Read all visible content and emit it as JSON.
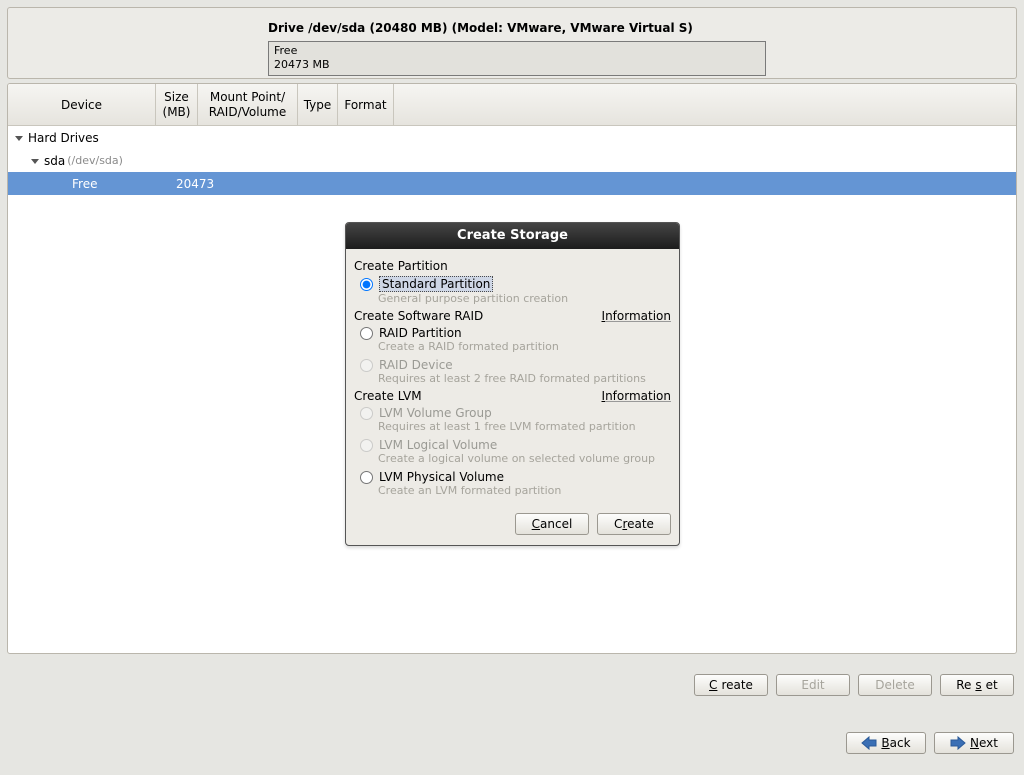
{
  "drive": {
    "title": "Drive /dev/sda (20480 MB) (Model: VMware, VMware Virtual S)",
    "free_label": "Free",
    "free_size": "20473 MB"
  },
  "columns": {
    "device": "Device",
    "size_l1": "Size",
    "size_l2": "(MB)",
    "mount_l1": "Mount Point/",
    "mount_l2": "RAID/Volume",
    "type": "Type",
    "format": "Format"
  },
  "tree": {
    "root_label": "Hard Drives",
    "sda_label": "sda",
    "sda_path": "(/dev/sda)",
    "free_label": "Free",
    "free_size": "20473"
  },
  "dialog": {
    "title": "Create Storage",
    "section_partition": "Create Partition",
    "opt_standard": "Standard Partition",
    "opt_standard_desc": "General purpose partition creation",
    "section_raid": "Create Software RAID",
    "info_label": "Information",
    "opt_raid_partition": "RAID Partition",
    "opt_raid_partition_desc": "Create a RAID formated partition",
    "opt_raid_device": "RAID Device",
    "opt_raid_device_desc": "Requires at least 2 free RAID formated partitions",
    "section_lvm": "Create LVM",
    "opt_lvm_vg": "LVM Volume Group",
    "opt_lvm_vg_desc": "Requires at least 1 free LVM formated partition",
    "opt_lvm_lv": "LVM Logical Volume",
    "opt_lvm_lv_desc": "Create a logical volume on selected volume group",
    "opt_lvm_pv": "LVM Physical Volume",
    "opt_lvm_pv_desc": "Create an LVM formated partition",
    "btn_cancel": "Cancel",
    "btn_create": "Create"
  },
  "bottom": {
    "create": "Create",
    "edit": "Edit",
    "delete": "Delete",
    "reset": "Reset",
    "back": "Back",
    "next": "Next"
  }
}
